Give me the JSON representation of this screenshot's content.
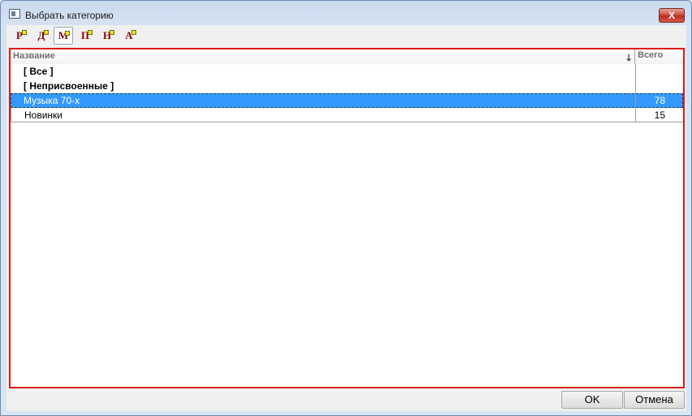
{
  "window": {
    "title": "Выбрать категорию",
    "close_glyph": "X"
  },
  "toolbar": {
    "buttons": [
      {
        "label": "Р",
        "icon": "r-filter-icon",
        "active": false
      },
      {
        "label": "Д",
        "icon": "d-filter-icon",
        "active": false
      },
      {
        "label": "М",
        "icon": "m-filter-icon",
        "active": true
      },
      {
        "label": "П",
        "icon": "p-filter-icon",
        "active": false
      },
      {
        "label": "Н",
        "icon": "n-filter-icon",
        "active": false
      },
      {
        "label": "А",
        "icon": "a-filter-icon",
        "active": false
      }
    ]
  },
  "table": {
    "columns": {
      "name": "Название",
      "total": "Всего"
    },
    "sort_glyph": "🡓",
    "rows": [
      {
        "name": "[ Все ]",
        "total": ""
      },
      {
        "name": "[ Неприсвоенные ]",
        "total": ""
      },
      {
        "name": "Музыка 70-х",
        "total": "78"
      },
      {
        "name": "Новинки",
        "total": "15"
      }
    ]
  },
  "footer": {
    "ok_label": "OK",
    "cancel_label": "Отмена"
  },
  "colors": {
    "selection": "#3399ff",
    "frame": "#d91a1a",
    "toolbar_glyph": "#8b0000"
  }
}
